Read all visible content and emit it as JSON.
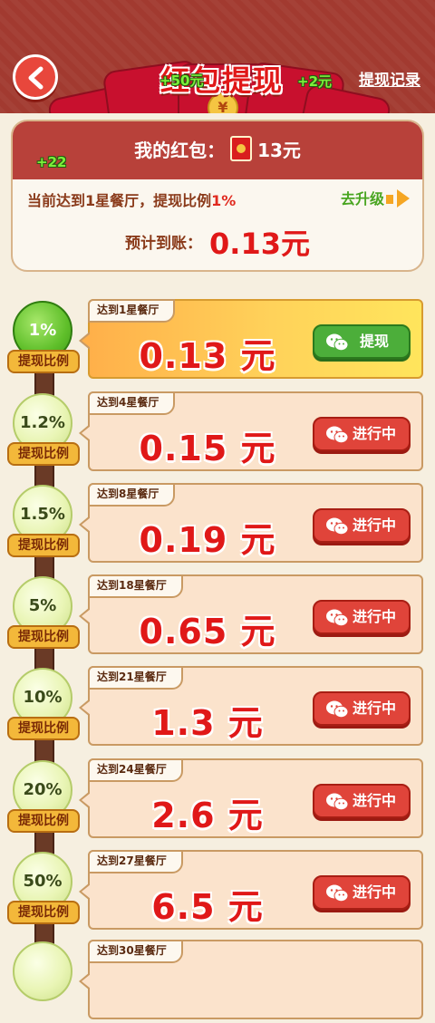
{
  "header": {
    "title": "红包提现",
    "record_label": "提现记录",
    "float_a": "+50元",
    "float_b": "+2元",
    "float_c": "+22",
    "coin_glyph": "¥"
  },
  "summary": {
    "wallet_label": "我的红包：",
    "wallet_amount": "13元",
    "level_prefix": "当前达到1星餐厅，提现比例",
    "level_pct": "1%",
    "upgrade_label": "去升级",
    "expect_label": "预计到账：",
    "expect_amount": "0.13元"
  },
  "tiers": [
    {
      "label": "达到1星餐厅",
      "ratio": "1%",
      "ratio_tag": "提现比例",
      "amount": "0.13 元",
      "button": "提现",
      "active": true
    },
    {
      "label": "达到4星餐厅",
      "ratio": "1.2%",
      "ratio_tag": "提现比例",
      "amount": "0.15 元",
      "button": "进行中",
      "active": false
    },
    {
      "label": "达到8星餐厅",
      "ratio": "1.5%",
      "ratio_tag": "提现比例",
      "amount": "0.19 元",
      "button": "进行中",
      "active": false
    },
    {
      "label": "达到18星餐厅",
      "ratio": "5%",
      "ratio_tag": "提现比例",
      "amount": "0.65 元",
      "button": "进行中",
      "active": false
    },
    {
      "label": "达到21星餐厅",
      "ratio": "10%",
      "ratio_tag": "提现比例",
      "amount": "1.3 元",
      "button": "进行中",
      "active": false
    },
    {
      "label": "达到24星餐厅",
      "ratio": "20%",
      "ratio_tag": "提现比例",
      "amount": "2.6 元",
      "button": "进行中",
      "active": false
    },
    {
      "label": "达到27星餐厅",
      "ratio": "50%",
      "ratio_tag": "提现比例",
      "amount": "6.5 元",
      "button": "进行中",
      "active": false
    },
    {
      "label": "达到30星餐厅",
      "ratio": "",
      "ratio_tag": "",
      "amount": "",
      "button": "",
      "active": false
    }
  ],
  "colors": {
    "header_bg": "#a23a30",
    "amount_red": "#e01818",
    "button_red": "#e0443a",
    "button_green": "#4cae3a"
  }
}
